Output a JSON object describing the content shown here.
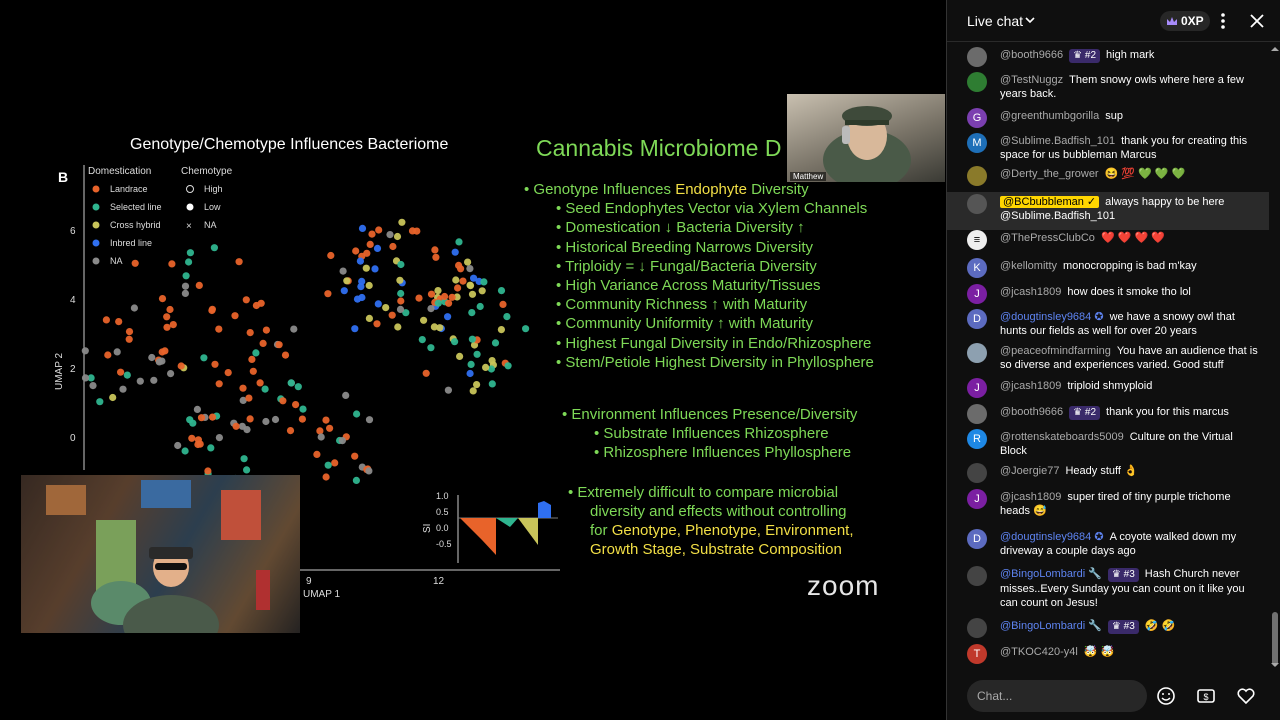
{
  "slide": {
    "figure_title": "Genotype/Chemotype Influences Bacteriome",
    "panel_letter": "B",
    "legend": {
      "domestication_header": "Domestication",
      "chemotype_header": "Chemotype",
      "domestication": [
        {
          "label": "Landrace",
          "color": "#e8632a"
        },
        {
          "label": "Selected line",
          "color": "#2fb58f"
        },
        {
          "label": "Cross hybrid",
          "color": "#c8c45a"
        },
        {
          "label": "Inbred line",
          "color": "#2f6ff0"
        },
        {
          "label": "NA",
          "color": "#8a8a8a"
        }
      ],
      "chemotype": [
        "High",
        "Low",
        "NA"
      ]
    },
    "y_axis_label": "UMAP 2",
    "x_axis_label": "UMAP 1",
    "y_ticks": [
      "6",
      "4",
      "2",
      "0"
    ],
    "x_ticks": [
      "9",
      "12"
    ],
    "inset": {
      "y_label": "SI",
      "y_ticks": [
        "1.0",
        "0.5",
        "0.0",
        "-0.5"
      ]
    },
    "heading": "Cannabis Microbiome D",
    "bullets": [
      {
        "level": 1,
        "text": "Genotype Influences ",
        "highlight": "Endophyte",
        "after": " Diversity"
      },
      {
        "level": 2,
        "text": "Seed Endophytes Vector via Xylem Channels"
      },
      {
        "level": 2,
        "text": "Domestication ↓ Bacteria Diversity ↑"
      },
      {
        "level": 2,
        "text": "Historical Breeding Narrows Diversity"
      },
      {
        "level": 2,
        "text": "Triploidy = ↓ Fungal/Bacteria Diversity"
      },
      {
        "level": 2,
        "text": "High Variance Across Maturity/Tissues"
      },
      {
        "level": 2,
        "text": "Community Richness ↑ with Maturity"
      },
      {
        "level": 2,
        "text": "Community Uniformity ↑ with Maturity"
      },
      {
        "level": 2,
        "text": "Highest Fungal Diversity in Endo/Rhizosphere"
      },
      {
        "level": 2,
        "text": "Stem/Petiole Highest Diversity in Phyllosphere"
      }
    ],
    "bullets2": [
      {
        "level": 1,
        "text": "Environment Influences Presence/Diversity"
      },
      {
        "level": 2,
        "text": "Substrate Influences Rhizosphere"
      },
      {
        "level": 2,
        "text": "Rhizosphere Influences Phyllosphere"
      }
    ],
    "bullet3_lines": [
      "Extremely difficult to compare microbial",
      "diversity and effects without controlling"
    ],
    "bullet3_line3_prefix": "for ",
    "bullet3_line3_highlight": "Genotype, Phenotype, Environment,",
    "bullet3_line4_highlight": "Growth Stage, Substrate Composition",
    "zoom_logo": "zoom"
  },
  "webcam": {
    "name": "Matthew"
  },
  "chat": {
    "title": "Live chat",
    "xp": "0XP",
    "input_placeholder": "Chat...",
    "messages": [
      {
        "author": "@booth9666",
        "badge": "#2",
        "text": "high mark",
        "avatar_color": "#6b6b6b",
        "avatar_letter": ""
      },
      {
        "author": "@TestNuggz",
        "text": "Them snowy owls where here a few years back.",
        "avatar_color": "#2e7d32",
        "avatar_letter": ""
      },
      {
        "author": "@greenthumbgorilla",
        "text": "sup",
        "avatar_color": "#7b3fb0",
        "avatar_letter": "G"
      },
      {
        "author": "@Sublime.Badfish_101",
        "text": "thank you for creating this space for us bubbleman Marcus",
        "avatar_color": "#1e6fb8",
        "avatar_letter": "M"
      },
      {
        "author": "@Derty_the_grower",
        "text": "😆 💯 💚 💚 💚",
        "avatar_color": "#8a7a2a",
        "avatar_letter": ""
      },
      {
        "author": "@BCbubbleman ✓",
        "owner": true,
        "text": "always happy to be here @Sublime.Badfish_101",
        "avatar_color": "#555",
        "avatar_letter": ""
      },
      {
        "author": "@ThePressClubCo",
        "text": "❤️ ❤️ ❤️ ❤️",
        "avatar_color": "#eeeeee",
        "avatar_letter": "≡"
      },
      {
        "author": "@kellomitty",
        "text": "monocropping is bad m'kay",
        "avatar_color": "#5c6bc0",
        "avatar_letter": "K"
      },
      {
        "author": "@jcash1809",
        "text": "how does it smoke tho lol",
        "avatar_color": "#7b1fa2",
        "avatar_letter": "J"
      },
      {
        "author": "@dougtinsley9684 ✪",
        "mod": true,
        "text": "we have a snowy owl that hunts our fields as well for over 20 years",
        "avatar_color": "#5c6bc0",
        "avatar_letter": "D"
      },
      {
        "author": "@peaceofmindfarming",
        "text": "You have an audience that is so diverse and experiences varied. Good stuff",
        "avatar_color": "#8da0b0",
        "avatar_letter": ""
      },
      {
        "author": "@jcash1809",
        "text": "triploid shmyploid",
        "avatar_color": "#7b1fa2",
        "avatar_letter": "J"
      },
      {
        "author": "@booth9666",
        "badge": "#2",
        "text": "thank you for this marcus",
        "avatar_color": "#6b6b6b",
        "avatar_letter": ""
      },
      {
        "author": "@rottenskateboards5009",
        "text": "Culture on the Virtual Block",
        "avatar_color": "#1e88e5",
        "avatar_letter": "R"
      },
      {
        "author": "@Joergie77",
        "text": "Heady stuff 👌",
        "avatar_color": "#444",
        "avatar_letter": ""
      },
      {
        "author": "@jcash1809",
        "text": "super tired of tiny purple trichome heads 😅",
        "avatar_color": "#7b1fa2",
        "avatar_letter": "J"
      },
      {
        "author": "@dougtinsley9684 ✪",
        "mod": true,
        "text": "A coyote walked down my driveway a couple days ago",
        "avatar_color": "#5c6bc0",
        "avatar_letter": "D"
      },
      {
        "author": "@BingoLombardi 🔧",
        "badge": "#3",
        "mod": true,
        "text": "Hash Church never misses..Every Sunday you can count on it like you can count on Jesus!",
        "avatar_color": "#444",
        "avatar_letter": ""
      },
      {
        "author": "@BingoLombardi 🔧",
        "badge": "#3",
        "mod": true,
        "text": "🤣 🤣",
        "avatar_color": "#444",
        "avatar_letter": ""
      },
      {
        "author": "@TKOC420-y4l",
        "text": "🤯 🤯",
        "avatar_color": "#c0392b",
        "avatar_letter": "T"
      }
    ]
  }
}
